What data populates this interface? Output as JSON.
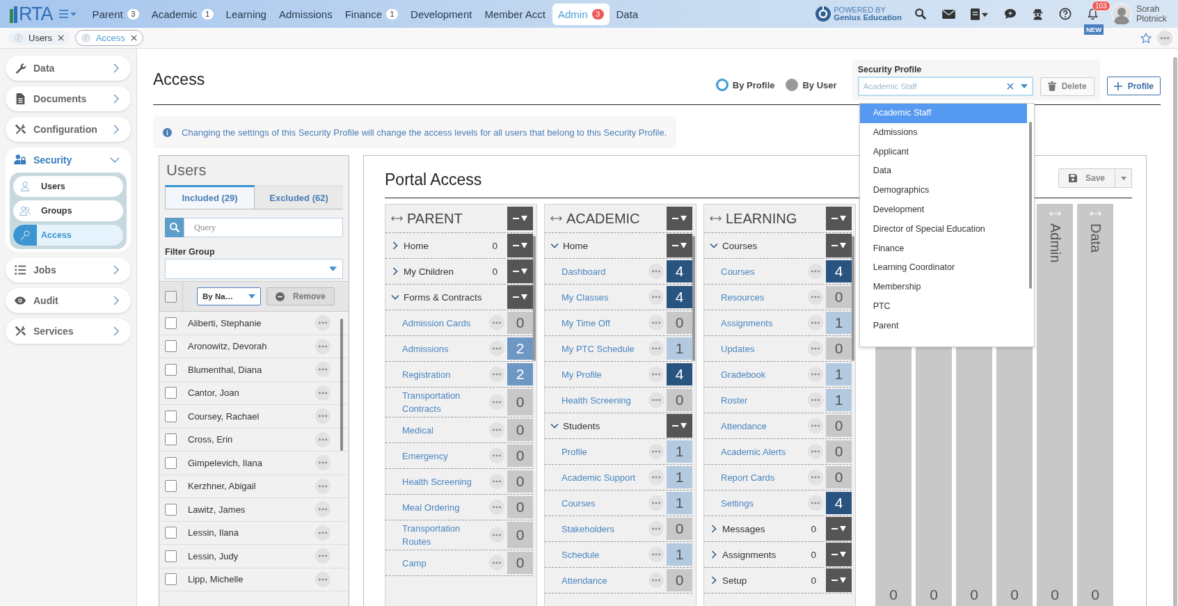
{
  "topbar": {
    "logo": "RTA",
    "nav": [
      {
        "label": "Parent",
        "badge": "3",
        "selected": false
      },
      {
        "label": "Academic",
        "badge": "1",
        "selected": false
      },
      {
        "label": "Learning",
        "selected": false
      },
      {
        "label": "Admissions",
        "selected": false
      },
      {
        "label": "Finance",
        "badge": "1",
        "selected": false
      },
      {
        "label": "Development",
        "selected": false
      },
      {
        "label": "Member Acct",
        "selected": false
      },
      {
        "label": "Admin",
        "badge": "3",
        "selected": true
      },
      {
        "label": "Data",
        "selected": false
      }
    ],
    "powered_by": {
      "line_1": "POWERED BY",
      "line_2": "Genius Education"
    },
    "notifications": {
      "count": "103",
      "tag": "NEW"
    },
    "user": {
      "name": "Sorah Plotnick"
    }
  },
  "open_tabs": [
    {
      "label": "Users",
      "selected": false
    },
    {
      "label": "Access",
      "selected": true
    }
  ],
  "sidebar": {
    "items": [
      {
        "label": "Data",
        "expanded": false
      },
      {
        "label": "Documents",
        "expanded": false
      },
      {
        "label": "Configuration",
        "expanded": false
      },
      {
        "label": "Security",
        "expanded": true,
        "children": [
          {
            "label": "Users",
            "selected": false
          },
          {
            "label": "Groups",
            "selected": false
          },
          {
            "label": "Access",
            "selected": true
          }
        ]
      },
      {
        "label": "Jobs",
        "expanded": false
      },
      {
        "label": "Audit",
        "expanded": false
      },
      {
        "label": "Services",
        "expanded": false
      }
    ]
  },
  "page": {
    "title": "Access",
    "view_mode": [
      {
        "label": "By Profile",
        "selected": true
      },
      {
        "label": "By User",
        "selected": false
      }
    ],
    "security_profile": {
      "label": "Security Profile",
      "placeholder": "Academic Staff",
      "options": [
        {
          "label": "Academic Staff",
          "selected": true
        },
        {
          "label": "Admissions",
          "selected": false
        },
        {
          "label": "Applicant",
          "selected": false
        },
        {
          "label": "Data",
          "selected": false
        },
        {
          "label": "Demographics",
          "selected": false
        },
        {
          "label": "Development",
          "selected": false
        },
        {
          "label": "Director of Special Education",
          "selected": false
        },
        {
          "label": "Finance",
          "selected": false
        },
        {
          "label": "Learning Coordinator",
          "selected": false
        },
        {
          "label": "Membership",
          "selected": false
        },
        {
          "label": "PTC",
          "selected": false
        },
        {
          "label": "Parent",
          "selected": false
        }
      ]
    },
    "delete_button": "Delete",
    "add_button": "Profile",
    "info": "Changing the settings of this Security Profile will change the access levels for all users that belong to this Security Profile.",
    "users_panel": {
      "title": "Users",
      "tabs": [
        {
          "label": "Included (29)",
          "selected": true
        },
        {
          "label": "Excluded (62)",
          "selected": false
        }
      ],
      "search": {
        "placeholder": "Query"
      },
      "filter_group": {
        "label": "Filter Group"
      },
      "select_all": {
        "checked": false
      },
      "sort": "By Na…",
      "remove": {
        "label": "Remove",
        "disabled": true
      },
      "users": [
        {
          "name": "Aliberti, Stephanie",
          "checked": false
        },
        {
          "name": "Aronowitz, Devorah",
          "checked": false
        },
        {
          "name": "Blumenthal, Diana",
          "checked": false
        },
        {
          "name": "Cantor, Joan",
          "checked": false
        },
        {
          "name": "Coursey, Rachael",
          "checked": false
        },
        {
          "name": "Cross, Erin",
          "checked": false
        },
        {
          "name": "Gimpelevich, Ilana",
          "checked": false
        },
        {
          "name": "Kerzhner, Abigail",
          "checked": false
        },
        {
          "name": "Lawitz, James",
          "checked": false
        },
        {
          "name": "Lessin, Ilana",
          "checked": false
        },
        {
          "name": "Lessin, Judy",
          "checked": false
        },
        {
          "name": "Lipp, Michelle",
          "checked": false
        }
      ]
    },
    "portal": {
      "title": "Portal Access",
      "save": {
        "label": "Save",
        "disabled": true
      },
      "columns": [
        {
          "title": "PARENT",
          "items": [
            {
              "label": "Home",
              "count": "0",
              "expanded": false
            },
            {
              "label": "My Children",
              "count": "0",
              "expanded": false
            },
            {
              "label": "Forms & Contracts",
              "expanded": true,
              "children": [
                {
                  "label": "Admission Cards",
                  "access": "0",
                  "color": "#c8c8c8"
                },
                {
                  "label": "Admissions",
                  "access": "2",
                  "color": "#6e97c3"
                },
                {
                  "label": "Registration",
                  "access": "2",
                  "color": "#6e97c3"
                },
                {
                  "label": "Transportation Contracts",
                  "access": "0",
                  "color": "#c8c8c8"
                },
                {
                  "label": "Medical",
                  "access": "0",
                  "color": "#c8c8c8"
                },
                {
                  "label": "Emergency",
                  "access": "0",
                  "color": "#c8c8c8"
                },
                {
                  "label": "Health Screening",
                  "access": "0",
                  "color": "#c8c8c8"
                },
                {
                  "label": "Meal Ordering",
                  "access": "0",
                  "color": "#c8c8c8"
                },
                {
                  "label": "Transportation Routes",
                  "access": "0",
                  "color": "#c8c8c8"
                },
                {
                  "label": "Camp",
                  "access": "0",
                  "color": "#c8c8c8"
                }
              ]
            }
          ]
        },
        {
          "title": "ACADEMIC",
          "items": [
            {
              "label": "Home",
              "expanded": true,
              "children": [
                {
                  "label": "Dashboard",
                  "access": "4",
                  "color": "#2a5480"
                },
                {
                  "label": "My Classes",
                  "access": "4",
                  "color": "#2a5480"
                },
                {
                  "label": "My Time Off",
                  "access": "0",
                  "color": "#c8c8c8"
                },
                {
                  "label": "My PTC Schedule",
                  "access": "1",
                  "color": "#b3c9e0"
                },
                {
                  "label": "My Profile",
                  "access": "4",
                  "color": "#2a5480"
                },
                {
                  "label": "Health Screening",
                  "access": "0",
                  "color": "#c8c8c8"
                }
              ]
            },
            {
              "label": "Students",
              "expanded": true,
              "children": [
                {
                  "label": "Profile",
                  "access": "1",
                  "color": "#b3c9e0"
                },
                {
                  "label": "Academic Support",
                  "access": "1",
                  "color": "#b3c9e0"
                },
                {
                  "label": "Courses",
                  "access": "1",
                  "color": "#b3c9e0"
                },
                {
                  "label": "Stakeholders",
                  "access": "0",
                  "color": "#c8c8c8"
                },
                {
                  "label": "Schedule",
                  "access": "1",
                  "color": "#b3c9e0"
                },
                {
                  "label": "Attendance",
                  "access": "0",
                  "color": "#c8c8c8"
                }
              ]
            }
          ]
        },
        {
          "title": "LEARNING",
          "items": [
            {
              "label": "Courses",
              "expanded": true,
              "children": [
                {
                  "label": "Courses",
                  "access": "4",
                  "color": "#2a5480"
                },
                {
                  "label": "Resources",
                  "access": "0",
                  "color": "#c8c8c8"
                },
                {
                  "label": "Assignments",
                  "access": "1",
                  "color": "#b3c9e0"
                },
                {
                  "label": "Updates",
                  "access": "0",
                  "color": "#c8c8c8"
                },
                {
                  "label": "Gradebook",
                  "access": "1",
                  "color": "#b3c9e0"
                },
                {
                  "label": "Roster",
                  "access": "1",
                  "color": "#b3c9e0"
                },
                {
                  "label": "Attendance",
                  "access": "0",
                  "color": "#c8c8c8"
                },
                {
                  "label": "Academic Alerts",
                  "access": "0",
                  "color": "#c8c8c8"
                },
                {
                  "label": "Report Cards",
                  "access": "0",
                  "color": "#c8c8c8"
                },
                {
                  "label": "Settings",
                  "access": "4",
                  "color": "#2a5480"
                }
              ]
            },
            {
              "label": "Messages",
              "count": "0",
              "expanded": false
            },
            {
              "label": "Assignments",
              "count": "0",
              "expanded": false
            },
            {
              "label": "Setup",
              "count": "0",
              "expanded": false
            }
          ]
        }
      ],
      "collapsed_columns": [
        {
          "count": "0"
        },
        {
          "count": "0"
        },
        {
          "count": "0"
        },
        {
          "count": "0"
        },
        {
          "label": "Admin",
          "count": "0"
        },
        {
          "label": "Data",
          "count": "0"
        }
      ]
    }
  }
}
